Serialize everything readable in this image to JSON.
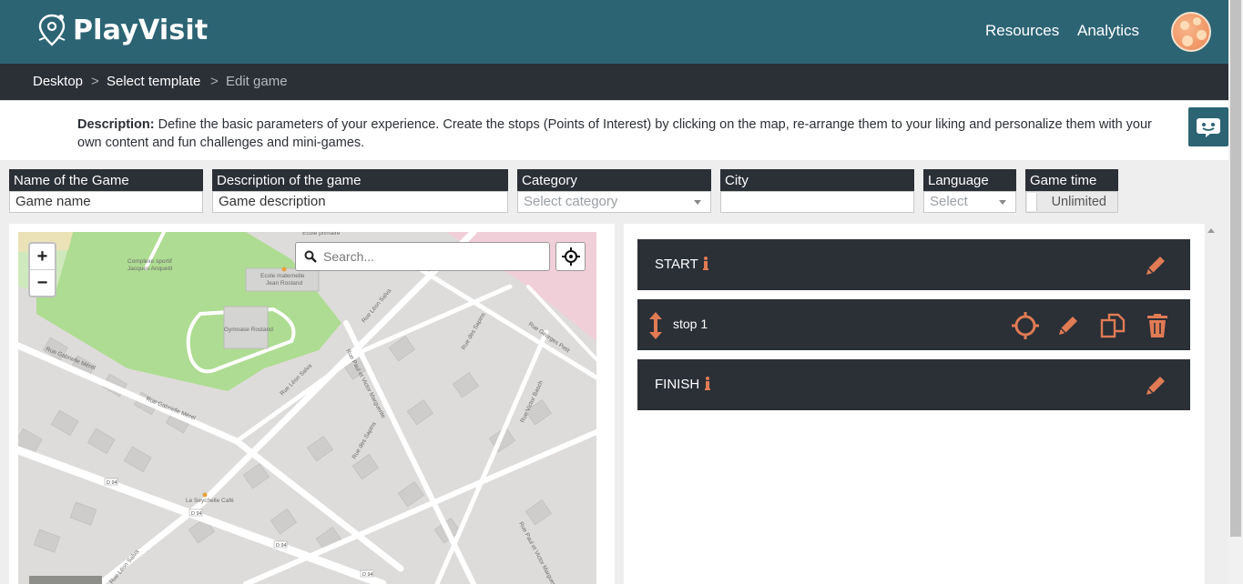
{
  "header": {
    "brand": "PlayVisit",
    "nav": [
      "Resources",
      "Analytics"
    ],
    "colors": {
      "topbar": "#2c6474",
      "accent": "#e07b54",
      "dark": "#2b2f36"
    }
  },
  "breadcrumb": {
    "items": [
      "Desktop",
      "Select template",
      "Edit game"
    ],
    "separator": ">"
  },
  "description": {
    "label": "Description:",
    "text": " Define the basic parameters of your experience. Create the stops (Points of Interest) by clicking on the map, re-arrange them to your liking and personalize them with your own content and fun challenges and mini-games."
  },
  "form": {
    "name": {
      "label": "Name of the Game",
      "placeholder": "Game name"
    },
    "description": {
      "label": "Description of the game",
      "placeholder": "Game description"
    },
    "category": {
      "label": "Category",
      "placeholder": "Select category"
    },
    "city": {
      "label": "City",
      "value": ""
    },
    "language": {
      "label": "Language",
      "placeholder": "Select"
    },
    "game_time": {
      "label": "Game time",
      "value": "Unlimited"
    }
  },
  "map": {
    "search_placeholder": "Search...",
    "zoom_in": "+",
    "zoom_out": "−",
    "labels": [
      "Complexe sportif Jacques Anquetil",
      "Ecole primaire Jean Rostand",
      "Ecole maternelle Jean Rostand",
      "Gymnase Rostand",
      "Rue Léon Salva",
      "Rue Gabrielle Mérel",
      "Rue des Sapins",
      "Rue Paul et Victor Marguerite",
      "Rue Georges Petit",
      "Rue Victor Basch",
      "Le Seychelle Café",
      "D 94"
    ]
  },
  "stops": [
    {
      "name": "START",
      "info": true,
      "icons": [
        "pencil-icon"
      ]
    },
    {
      "name": "stop 1",
      "info": false,
      "icons": [
        "locate-icon",
        "pencil-icon",
        "copy-icon",
        "trash-icon"
      ]
    },
    {
      "name": "FINISH",
      "info": true,
      "icons": [
        "pencil-icon"
      ]
    }
  ]
}
